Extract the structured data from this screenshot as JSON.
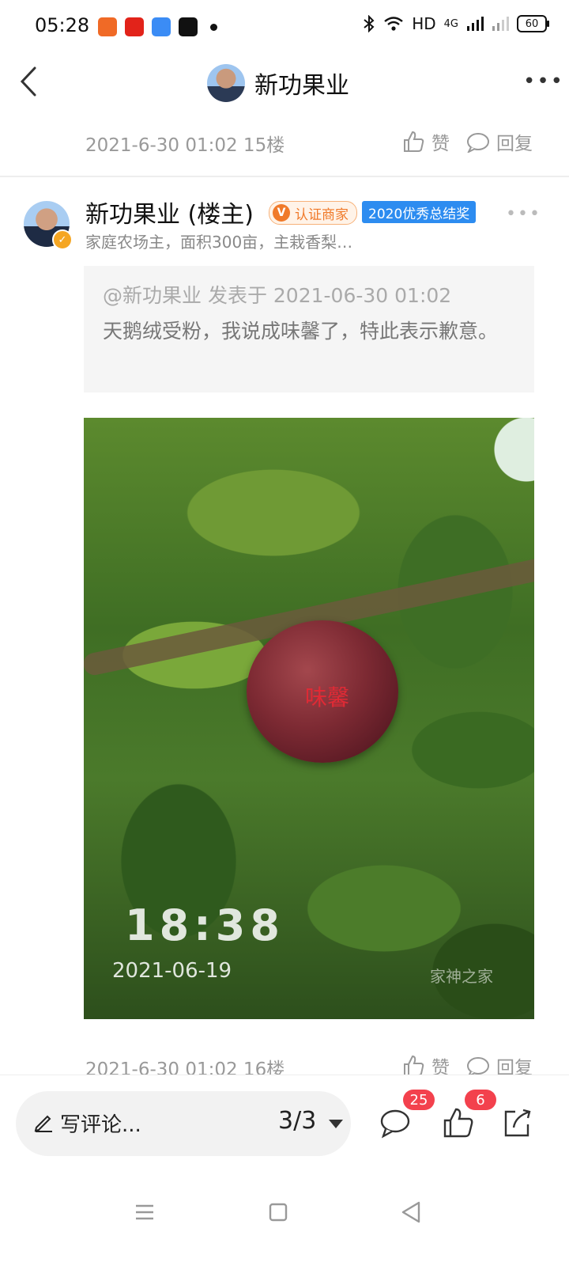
{
  "status_bar": {
    "time": "05:28",
    "network": "HD",
    "signal": "4G",
    "battery": "60",
    "app_icons": [
      "ikea-like-app-icon",
      "jingdong-icon",
      "blue-chat-icon",
      "tiktok-icon"
    ]
  },
  "header": {
    "title": "新功果业"
  },
  "floor_15": {
    "meta": "2021-6-30 01:02  15楼",
    "like_label": "赞",
    "reply_label": "回复"
  },
  "post": {
    "author": "新功果业 (楼主)",
    "verified_label": "认证商家",
    "verified_mark": "V",
    "award_label": "2020优秀总结奖",
    "bio": "家庭农场主，面积300亩，主栽香梨…",
    "quote_header": "@新功果业 发表于 2021-06-30 01:02",
    "quote_body": "天鹅绒受粉，我说成味馨了，特此表示歉意。",
    "photo": {
      "fruit_label": "味馨",
      "time_stamp": "18:38",
      "date_stamp": "2021-06-19",
      "watermark": "家神之家"
    }
  },
  "floor_16": {
    "meta": "2021-6-30 01:02  16楼",
    "like_label": "赞",
    "reply_label": "回复"
  },
  "bottom_bar": {
    "comment_placeholder": "写评论...",
    "page_indicator": "3/3",
    "comment_count": "25",
    "like_count": "6"
  },
  "colors": {
    "badge_red": "#f3414d",
    "verified_orange": "#f07a2a",
    "award_blue": "#2d8cf0"
  }
}
